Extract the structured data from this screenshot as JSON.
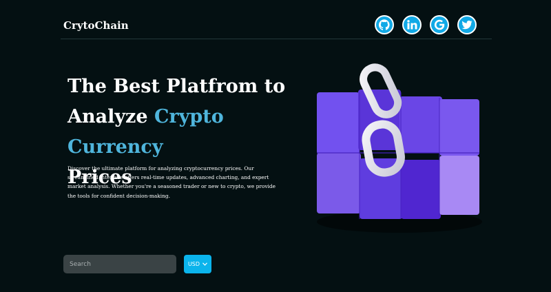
{
  "brand": {
    "name": "CrytoChain"
  },
  "social": [
    {
      "name": "github-icon"
    },
    {
      "name": "linkedin-icon"
    },
    {
      "name": "google-icon"
    },
    {
      "name": "twitter-icon"
    }
  ],
  "hero": {
    "title_line1": "The Best Platfrom to",
    "title_prefix": "Analyze ",
    "title_accent": "Crypto Currency",
    "title_line3": "Prices",
    "description": "Discover the ultimate platform for analyzing cryptocurrency prices. Our streamlined interface offers real-time updates, advanced charting, and expert market analysis. Whether you're a seasoned trader or new to crypto, we provide the tools for confident decision-making."
  },
  "search": {
    "placeholder": "Search"
  },
  "currency": {
    "selected": "USD"
  },
  "colors": {
    "background": "#041012",
    "accent": "#4fb5dc",
    "social_bg": "#11a9e6",
    "currency_bg": "#0bb4ec",
    "cube_violet": "#6d48e8"
  }
}
